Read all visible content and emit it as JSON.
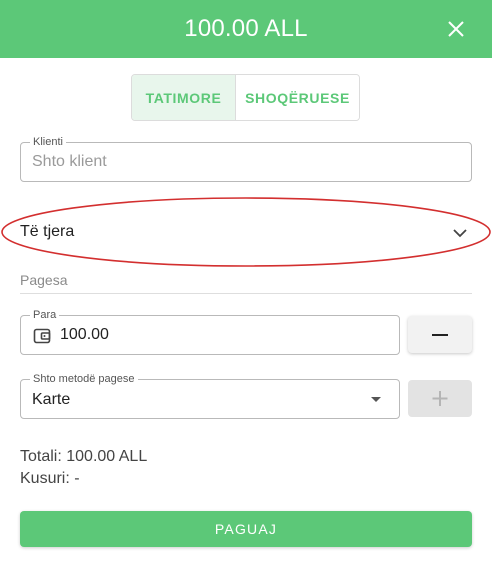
{
  "header": {
    "title": "100.00 ALL",
    "close_icon": "close-icon",
    "background_color": "#5cc878"
  },
  "invoice_type_toggle": {
    "options": [
      "TATIMORE",
      "SHOQËRUESE"
    ],
    "selected": "TATIMORE"
  },
  "client": {
    "label": "Klienti",
    "placeholder": "Shto klient",
    "value": ""
  },
  "category": {
    "value": "Të tjera",
    "icon": "chevron-down-icon"
  },
  "payment": {
    "section_label": "Pagesa",
    "amount_label": "Para",
    "amount_value": "100.00",
    "amount_icon": "wallet-icon",
    "remove_icon": "minus-icon",
    "method_label": "Shto metodë pagese",
    "method_value": "Karte",
    "add_icon": "plus-icon"
  },
  "totals": {
    "total_text": "Totali: 100.00 ALL",
    "change_text": "Kusuri: -"
  },
  "actions": {
    "pay_label": "PAGUAJ"
  },
  "colors": {
    "accent": "#5cc878",
    "annotation": "#d32f2f"
  }
}
